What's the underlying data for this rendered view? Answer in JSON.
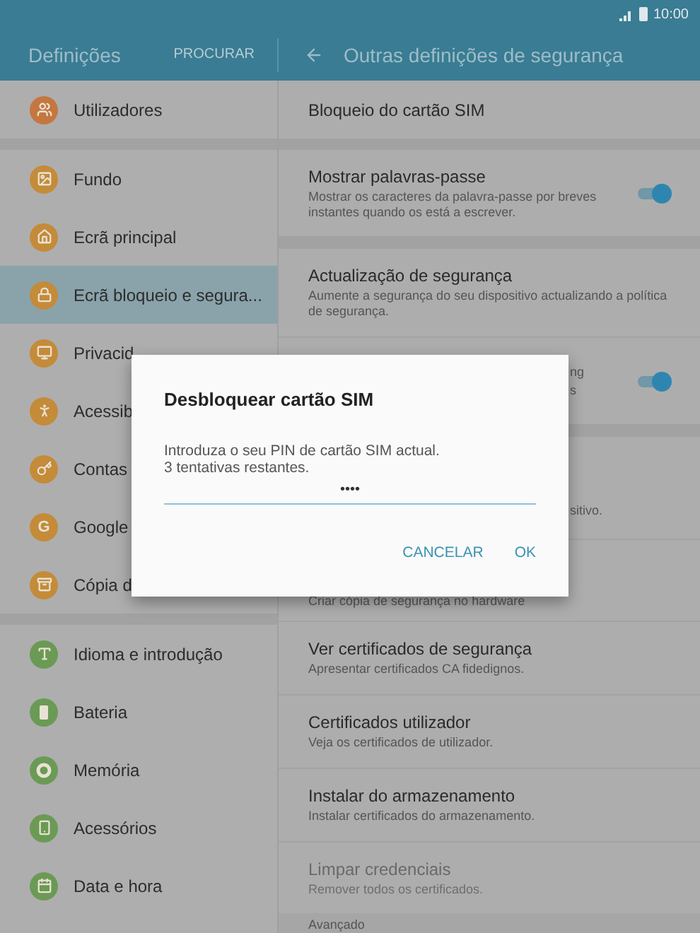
{
  "status_bar": {
    "time": "10:00"
  },
  "header": {
    "title": "Definições",
    "search": "PROCURAR",
    "page_title": "Outras definições de segurança"
  },
  "sidebar": {
    "groups": [
      [
        {
          "label": "Utilizadores",
          "color": "#c4773f",
          "selected": false
        }
      ],
      [
        {
          "label": "Fundo",
          "color": "#c48b39",
          "selected": false
        },
        {
          "label": "Ecrã principal",
          "color": "#c48b39",
          "selected": false
        },
        {
          "label": "Ecrã bloqueio e segura...",
          "color": "#c48b39",
          "selected": true
        },
        {
          "label": "Privacid",
          "color": "#c48b39",
          "selected": false
        },
        {
          "label": "Acessib",
          "color": "#c48b39",
          "selected": false
        },
        {
          "label": "Contas",
          "color": "#c48b39",
          "selected": false
        },
        {
          "label": "Google",
          "color": "#c48b39",
          "selected": false,
          "icon_letter": "G"
        },
        {
          "label": "Cópia d",
          "color": "#c48b39",
          "selected": false
        }
      ],
      [
        {
          "label": "Idioma e introdução",
          "color": "#6b9a55",
          "selected": false
        },
        {
          "label": "Bateria",
          "color": "#6b9a55",
          "selected": false
        },
        {
          "label": "Memória",
          "color": "#6b9a55",
          "selected": false
        },
        {
          "label": "Acessórios",
          "color": "#6b9a55",
          "selected": false
        },
        {
          "label": "Data e hora",
          "color": "#6b9a55",
          "selected": false
        }
      ]
    ]
  },
  "settings": {
    "groups": [
      [
        {
          "kind": "plain",
          "title": "Bloqueio do cartão SIM"
        }
      ],
      [
        {
          "kind": "plain",
          "title": "Mostrar palavras-passe",
          "subtitle": "Mostrar os caracteres da palavra-passe por breves instantes quando os está a escrever.",
          "toggle": {
            "on": true
          }
        }
      ],
      [
        {
          "kind": "plain",
          "title": "Actualização de segurança",
          "subtitle": "Aumente a segurança do seu dispositivo actualizando a política de segurança."
        },
        {
          "kind": "covered",
          "lines": [
            "ng",
            "s"
          ],
          "toggle": {
            "on": true
          }
        }
      ],
      [
        {
          "kind": "covered",
          "lines": [
            "sitivo."
          ]
        },
        {
          "kind": "plain",
          "subtitle": "Criar cópia de segurança no hardware"
        },
        {
          "kind": "plain",
          "title": "Ver certificados de segurança",
          "subtitle": "Apresentar certificados CA fidedignos."
        },
        {
          "kind": "plain",
          "title": "Certificados utilizador",
          "subtitle": "Veja os certificados de utilizador."
        },
        {
          "kind": "plain",
          "title": "Instalar do armazenamento",
          "subtitle": "Instalar certificados do armazenamento."
        },
        {
          "kind": "plain",
          "title": "Limpar credenciais",
          "subtitle": "Remover todos os certificados.",
          "disabled": true
        }
      ]
    ],
    "footer_header": "Avançado"
  },
  "dialog": {
    "title": "Desbloquear cartão SIM",
    "message": [
      "Introduza o seu PIN de cartão SIM actual.",
      "3 tentativas restantes."
    ],
    "pin": {
      "value": "••••"
    },
    "buttons": [
      "CANCELAR",
      "OK"
    ]
  }
}
